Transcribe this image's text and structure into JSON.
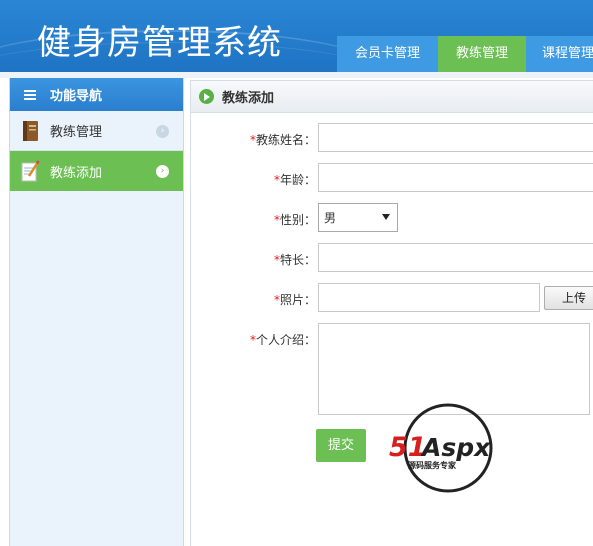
{
  "header": {
    "app_title": "健身房管理系统",
    "tabs": [
      {
        "label": "会员卡管理",
        "active": false
      },
      {
        "label": "教练管理",
        "active": true
      },
      {
        "label": "课程管理",
        "active": false
      }
    ]
  },
  "sidebar": {
    "title": "功能导航",
    "items": [
      {
        "label": "教练管理",
        "icon": "book-icon",
        "active": false
      },
      {
        "label": "教练添加",
        "icon": "notepad-pencil-icon",
        "active": true
      }
    ]
  },
  "main": {
    "title": "教练添加",
    "form": {
      "required_mark": "*",
      "name_label": "教练姓名：",
      "name_value": "",
      "age_label": "年龄：",
      "age_value": "",
      "gender_label": "性别：",
      "gender_selected": "男",
      "specialty_label": "特长：",
      "specialty_value": "",
      "photo_label": "照片：",
      "photo_value": "",
      "upload_label": "上传",
      "intro_label": "个人介绍：",
      "intro_value": "",
      "submit_label": "提交"
    }
  },
  "watermark": {
    "brand": "51Aspx",
    "tagline": "源码服务专家"
  },
  "colors": {
    "header_blue": "#2a86d4",
    "tab_blue": "#3d9ae3",
    "accent_green": "#6cbf53",
    "required_red": "#e02020"
  }
}
